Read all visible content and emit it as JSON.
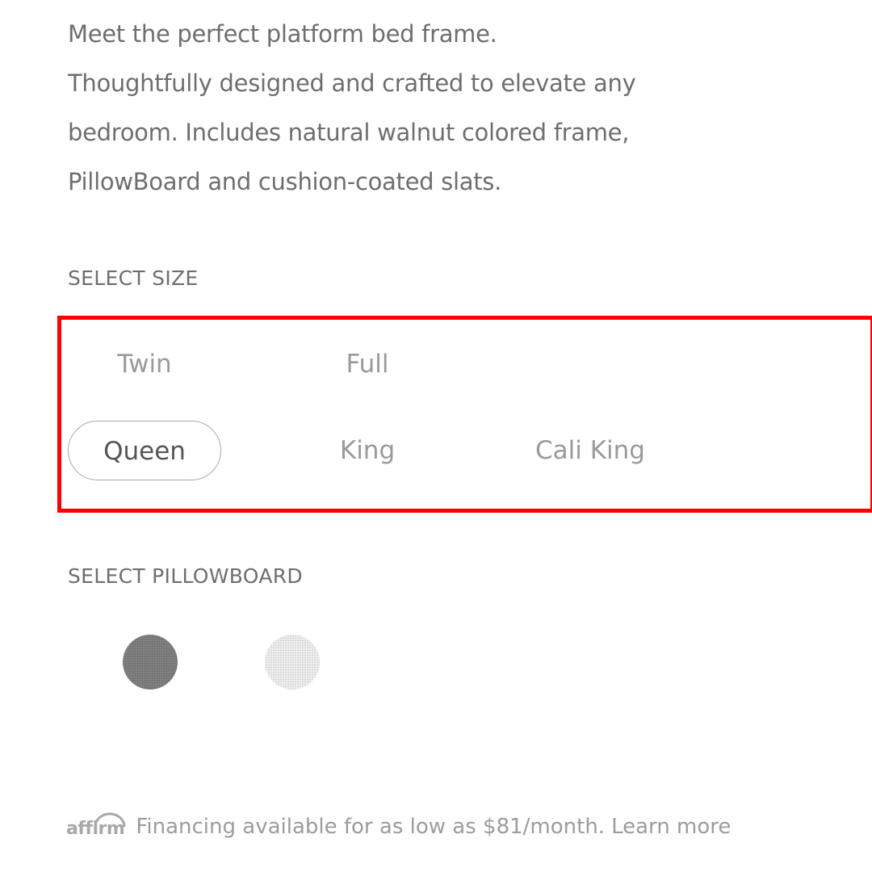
{
  "description": {
    "lines": [
      "Meet the perfect platform bed frame.",
      "Thoughtfully designed and crafted to elevate any",
      "bedroom. Includes natural walnut colored frame,",
      "PillowBoard and cushion-coated slats."
    ]
  },
  "size": {
    "label": "SELECT SIZE",
    "options": [
      "Twin",
      "Full",
      "Queen",
      "King",
      "Cali King"
    ],
    "selected": "Queen"
  },
  "pillowboard": {
    "label": "SELECT PILLOWBOARD",
    "swatches": [
      {
        "name": "charcoal-swatch",
        "color": "#7b7b7b"
      },
      {
        "name": "white-swatch",
        "color": "#e6e6e6"
      }
    ]
  },
  "financing": {
    "logo": "affirm",
    "text": "Financing available for as low as $81/month.",
    "link": "Learn more"
  },
  "highlight_color": "#ff0000"
}
